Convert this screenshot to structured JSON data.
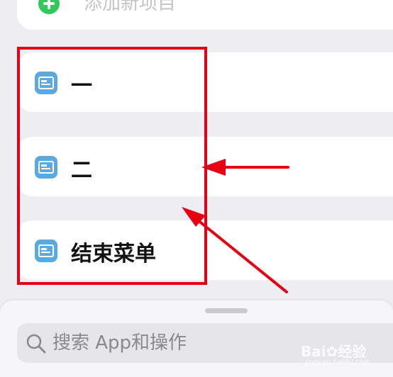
{
  "add_item": {
    "label": "添加新项目",
    "icon": "plus-circle-icon",
    "icon_color": "#34c759"
  },
  "menu_items": [
    {
      "label": "一",
      "icon": "text-document-icon"
    },
    {
      "label": "二",
      "icon": "text-document-icon"
    },
    {
      "label": "结束菜单",
      "icon": "text-document-icon"
    }
  ],
  "menu_icon_color": "#5aa9e0",
  "search": {
    "placeholder": "搜索 App和操作",
    "icon": "search-icon"
  },
  "annotation": {
    "color": "#e60012",
    "shapes": [
      "highlight-box",
      "arrow",
      "arrow"
    ]
  },
  "watermark": {
    "text": "Bai",
    "suffix": "经验",
    "url": "jingyan.baidu.com"
  }
}
